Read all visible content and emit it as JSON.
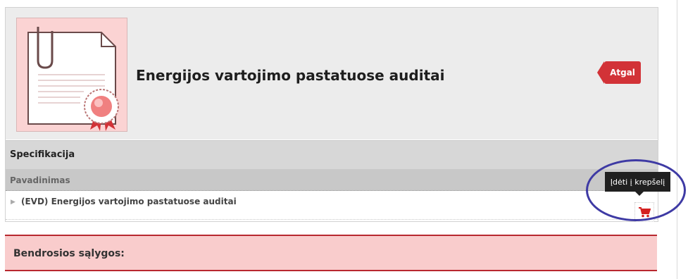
{
  "header": {
    "title": "Energijos vartojimo pastatuose auditai",
    "back_label": "Atgal"
  },
  "specification": {
    "title": "Specifikacija",
    "column_header": "Pavadinimas",
    "items": [
      {
        "label": "(EVD) Energijos vartojimo pastatuose auditai"
      }
    ]
  },
  "tooltip": {
    "text": "Įdėti į krepšelį"
  },
  "conditions": {
    "title": "Bendrosios sąlygos:"
  },
  "colors": {
    "accent": "#d23237",
    "highlight_circle": "#3e3aa4",
    "conditions_bg": "#f9cccc"
  },
  "icons": {
    "document": "certificate-document-icon",
    "expand": "triangle-right-icon",
    "cart": "shopping-cart-icon"
  }
}
